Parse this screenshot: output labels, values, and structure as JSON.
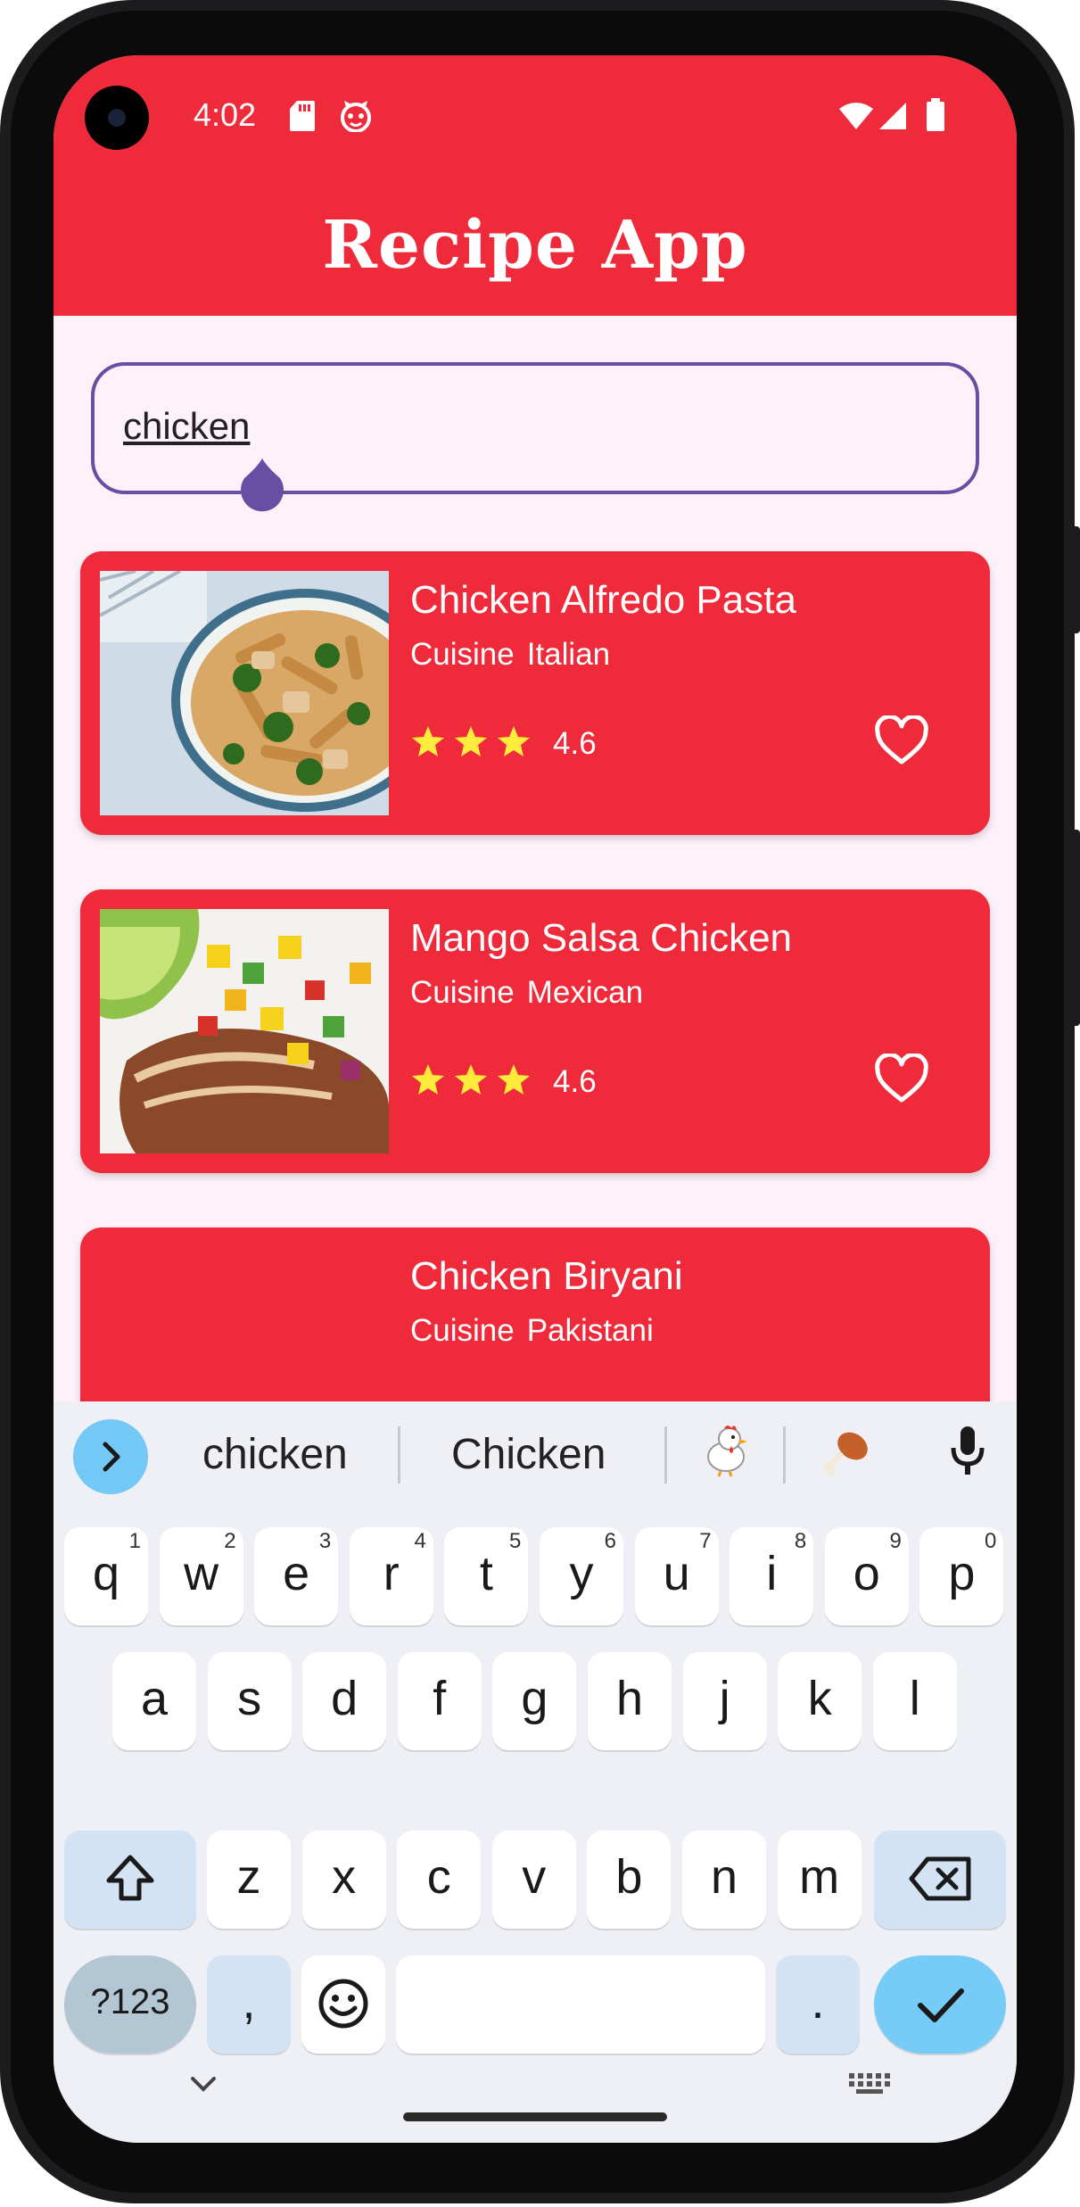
{
  "status_bar": {
    "time": "4:02"
  },
  "app": {
    "title": "Recipe App"
  },
  "search": {
    "value": "chicken"
  },
  "recipes": [
    {
      "title": "Chicken Alfredo Pasta",
      "cuisine_label": "Cuisine",
      "cuisine": "Italian",
      "rating": "4.6",
      "stars": 3
    },
    {
      "title": "Mango Salsa Chicken",
      "cuisine_label": "Cuisine",
      "cuisine": "Mexican",
      "rating": "4.6",
      "stars": 3
    },
    {
      "title": "Chicken Biryani",
      "cuisine_label": "Cuisine",
      "cuisine": "Pakistani"
    }
  ],
  "keyboard": {
    "suggestions": [
      "chicken",
      "Chicken"
    ],
    "row1": [
      {
        "key": "q",
        "hint": "1"
      },
      {
        "key": "w",
        "hint": "2"
      },
      {
        "key": "e",
        "hint": "3"
      },
      {
        "key": "r",
        "hint": "4"
      },
      {
        "key": "t",
        "hint": "5"
      },
      {
        "key": "y",
        "hint": "6"
      },
      {
        "key": "u",
        "hint": "7"
      },
      {
        "key": "i",
        "hint": "8"
      },
      {
        "key": "o",
        "hint": "9"
      },
      {
        "key": "p",
        "hint": "0"
      }
    ],
    "row2": [
      "a",
      "s",
      "d",
      "f",
      "g",
      "h",
      "j",
      "k",
      "l"
    ],
    "row3": [
      "z",
      "x",
      "c",
      "v",
      "b",
      "n",
      "m"
    ],
    "symbols_label": "?123",
    "comma": ",",
    "period": "."
  },
  "colors": {
    "primary": "#ee2a3b",
    "background": "#fdf2f9",
    "outline": "#6750a4",
    "star": "#ffeb3b",
    "keyboard_accent": "#77cbf7"
  }
}
